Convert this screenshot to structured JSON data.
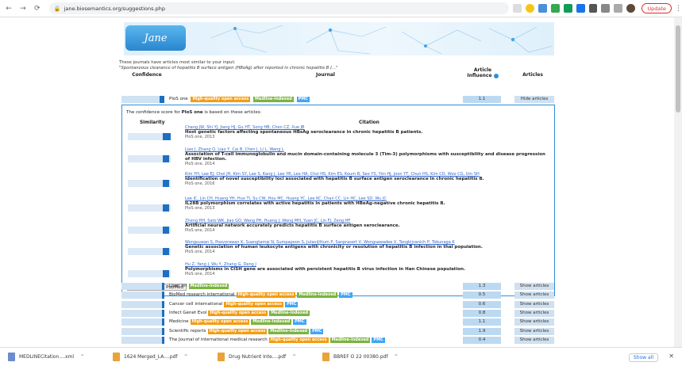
{
  "browser": {
    "url": "jane.biosemantics.org/suggestions.php",
    "update_label": "Update"
  },
  "intro": {
    "line1": "These journals have articles most similar to your input:",
    "line2": "\"Spontaneous clearance of hepatitis B surface antigen (HBsAg) after reported in chronic hepatitis B (...\""
  },
  "headers": {
    "confidence": "Confidence",
    "journal": "Journal",
    "influence": "Article Influence",
    "articles": "Articles"
  },
  "top_journal": {
    "name": "PloS one",
    "tags": [
      "High-quality open access",
      "Medline-indexed",
      "PMC"
    ],
    "confidence": 0.15,
    "influence": "1.1",
    "button": "Hide articles"
  },
  "detail": {
    "lead_prefix": "The confidence score for ",
    "lead_journal": "PloS one",
    "lead_suffix": " is based on these articles:",
    "col_similarity": "Similarity",
    "col_citation": "Citation",
    "pubmed_button": "Explore more in PubMed",
    "articles": [
      {
        "authors": "Chang JW, Shi YJ, Jiang HJ, Gu HT, Song HB, Chen CZ, Xue JB",
        "title": "Host genetic factors affecting spontaneous HBsAg seroclearance in chronic hepatitis B patients.",
        "journal": "PloS one, 2013",
        "sim": 0.3
      },
      {
        "authors": "Liao J, Zhang Q, Liao Y, Cai B, Chen J, Li L, Wang L",
        "title": "Association of T-cell immunoglobulin and mucin domain-containing molecule 3 (Tim-3) polymorphisms with susceptibility and disease progression of HBV infection.",
        "journal": "PloS one, 2014",
        "sim": 0.05
      },
      {
        "authors": "Kim YH, Lee EJ, Choi JH, Kim SY, Lee S, Kang J, Lee YR, Lee HA, Choi HS, Kim ES, Koum B, Seo YS, Yim HJ, Joon YT, Chun HS, Kim CD, Woo CG, Um SH",
        "title": "Identification of novel susceptibility loci associated with hepatitis B surface antigen seroclearance in chronic hepatitis B.",
        "journal": "PloS one, 2016",
        "sim": 0.0
      },
      {
        "authors": "Lee IC, Lin CH, Huang YH, Huo TI, Su CW, Hou MC, Huang YC, Lee KC, Chan CC, Lin HC, Lee SD, Wu JC",
        "title": "IL28B polymorphism correlates with active hepatitis in patients with HBeAg-negative chronic hepatitis B.",
        "journal": "PloS one, 2013",
        "sim": 0.0
      },
      {
        "authors": "Zheng HH, Sato WK, Jiao GO, Wang PH, Huang J, Wang MH, Yuan JC, Lin FJ, Zeng HF",
        "title": "Artificial neural network accurately predicts hepatitis B surface antigen seroclearance.",
        "journal": "PloS one, 2014",
        "sim": 0.0
      },
      {
        "authors": "Wongsuwan S, Poovorawan K, Suangtamai N, Sumpapoon S, Jutavijittum P, Sanprasert V, Wongsawadee V, Tangkijvanich P, Tokunaga K",
        "title": "Genetic association of human leukocyte antigens with chronicity or resolution of hepatitis B infection in thai population.",
        "journal": "PloS one, 2014",
        "sim": 0.0
      },
      {
        "authors": "Hu Z, Yang J, Wu Y, Zhang G, Deng J",
        "title": "Polymorphisms in CISH gene are associated with persistent hepatitis B virus infection in Han Chinese population.",
        "journal": "PloS one, 2014",
        "sim": 0.0
      }
    ]
  },
  "journals": [
    {
      "name": "Liver Int",
      "tags": [
        "Medline-indexed"
      ],
      "influence": "1.3",
      "button": "Show articles"
    },
    {
      "name": "BioMed research international",
      "tags": [
        "High-quality open access",
        "Medline-indexed",
        "PMC"
      ],
      "influence": "0.5",
      "button": "Show articles"
    },
    {
      "name": "Cancer cell international",
      "tags": [
        "High-quality open access",
        "PMC"
      ],
      "influence": "0.6",
      "button": "Show articles"
    },
    {
      "name": "Infect Genet Evol",
      "tags": [
        "High-quality open access",
        "Medline-indexed"
      ],
      "influence": "0.8",
      "button": "Show articles"
    },
    {
      "name": "Medicine",
      "tags": [
        "High-quality open access",
        "Medline-indexed",
        "PMC"
      ],
      "influence": "1.1",
      "button": "Show articles"
    },
    {
      "name": "Scientific reports",
      "tags": [
        "High-quality open access",
        "Medline-indexed",
        "PMC"
      ],
      "influence": "1.9",
      "button": "Show articles"
    },
    {
      "name": "The Journal of international medical research",
      "tags": [
        "High-quality open access",
        "Medline-indexed",
        "PMC"
      ],
      "influence": "0.4",
      "button": "Show articles"
    }
  ],
  "downloads": {
    "items": [
      {
        "name": "MEDLINECitation....xml",
        "color": "#6b8cce"
      },
      {
        "name": "1624 Merged_LA....pdf",
        "color": "#e8a33b"
      },
      {
        "name": "Drug Nutrient Inte....pdf",
        "color": "#e8a33b"
      },
      {
        "name": "BBREF O 22 00380.pdf",
        "color": "#e8a33b"
      }
    ],
    "show_all": "Show all"
  }
}
